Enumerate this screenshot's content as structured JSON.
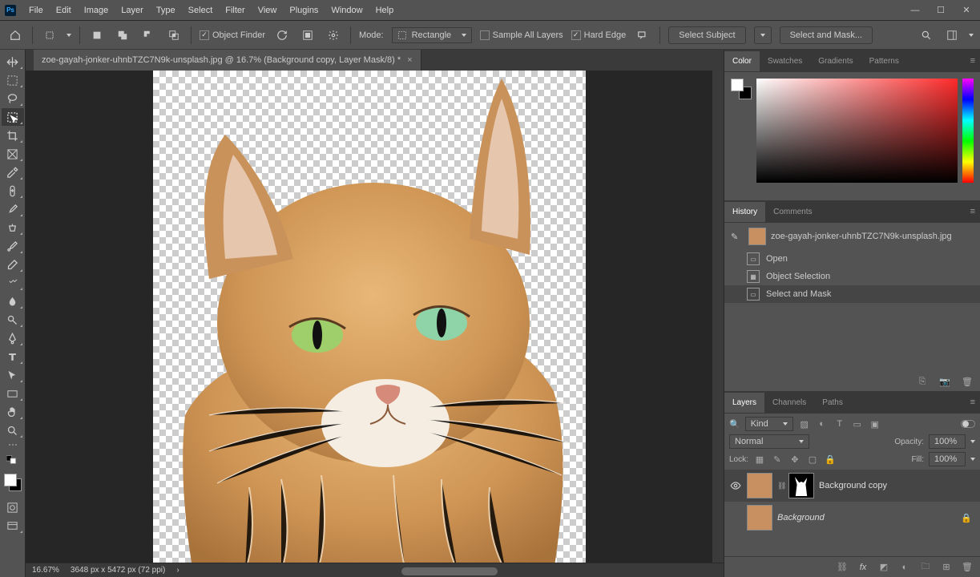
{
  "app": {
    "name": "Ps"
  },
  "menu": [
    "File",
    "Edit",
    "Image",
    "Layer",
    "Type",
    "Select",
    "Filter",
    "View",
    "Plugins",
    "Window",
    "Help"
  ],
  "optbar": {
    "object_finder": "Object Finder",
    "mode_label": "Mode:",
    "mode_value": "Rectangle",
    "sample_all": "Sample All Layers",
    "hard_edge": "Hard Edge",
    "select_subject": "Select Subject",
    "select_and_mask": "Select and Mask..."
  },
  "doc": {
    "tab": "zoe-gayah-jonker-uhnbTZC7N9k-unsplash.jpg @ 16.7% (Background copy, Layer Mask/8) *"
  },
  "status": {
    "zoom": "16.67%",
    "dims": "3648 px x 5472 px (72 ppi)"
  },
  "panels": {
    "color_tabs": [
      "Color",
      "Swatches",
      "Gradients",
      "Patterns"
    ],
    "history_tabs": [
      "History",
      "Comments"
    ],
    "history_doc": "zoe-gayah-jonker-uhnbTZC7N9k-unsplash.jpg",
    "history_items": [
      "Open",
      "Object Selection",
      "Select and Mask"
    ],
    "layers_tabs": [
      "Layers",
      "Channels",
      "Paths"
    ],
    "layer_kind": "Kind",
    "blend_mode": "Normal",
    "opacity_label": "Opacity:",
    "opacity_val": "100%",
    "lock_label": "Lock:",
    "fill_label": "Fill:",
    "fill_val": "100%",
    "layers": [
      {
        "name": "Background copy",
        "visible": true,
        "active": true,
        "hasMask": true
      },
      {
        "name": "Background",
        "visible": false,
        "active": false,
        "locked": true,
        "italic": true
      }
    ]
  }
}
